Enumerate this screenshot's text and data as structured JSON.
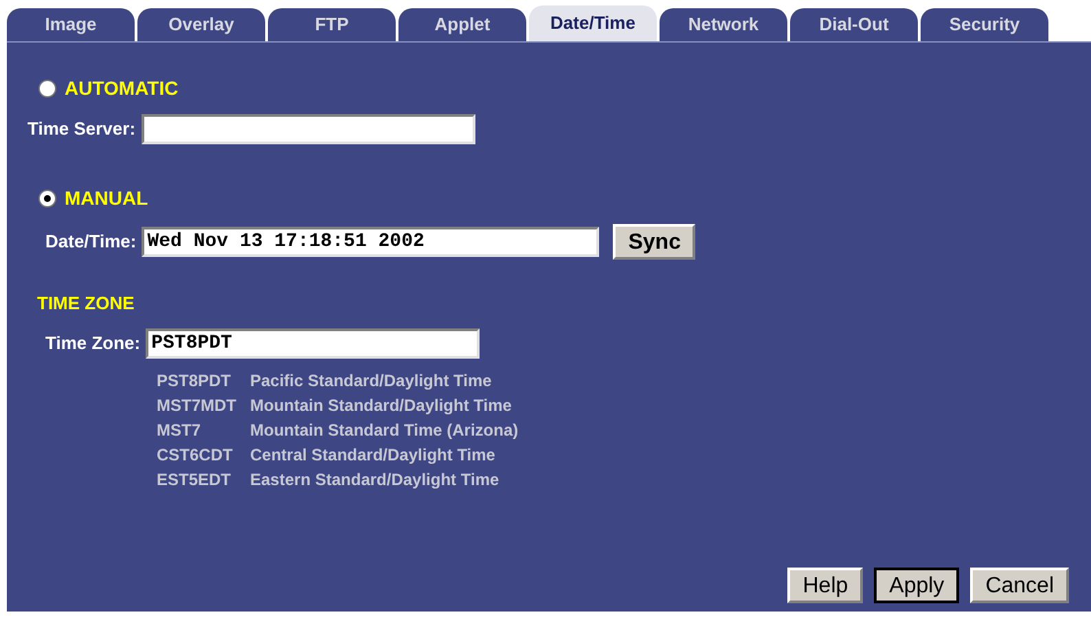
{
  "tabs": [
    {
      "label": "Image",
      "selected": false
    },
    {
      "label": "Overlay",
      "selected": false
    },
    {
      "label": "FTP",
      "selected": false
    },
    {
      "label": "Applet",
      "selected": false
    },
    {
      "label": "Date/Time",
      "selected": true
    },
    {
      "label": "Network",
      "selected": false
    },
    {
      "label": "Dial-Out",
      "selected": false
    },
    {
      "label": "Security",
      "selected": false
    }
  ],
  "automatic": {
    "label": "AUTOMATIC",
    "selected": false,
    "field_label": "Time Server:"
  },
  "manual": {
    "label": "MANUAL",
    "selected": true,
    "field_label": "Date/Time:",
    "value": "Wed Nov 13 17:18:51 2002",
    "button": "Sync"
  },
  "time_zone": {
    "heading": "TIME ZONE",
    "field_label": "Time Zone:",
    "value": "PST8PDT",
    "zones": [
      {
        "code": "PST8PDT",
        "name": "Pacific Standard/Daylight Time"
      },
      {
        "code": "MST7MDT",
        "name": "Mountain Standard/Daylight Time"
      },
      {
        "code": "MST7",
        "name": "Mountain Standard Time (Arizona)"
      },
      {
        "code": "CST6CDT",
        "name": "Central Standard/Daylight Time"
      },
      {
        "code": "EST5EDT",
        "name": "Eastern Standard/Daylight Time"
      }
    ]
  },
  "buttons": [
    {
      "label": "Help",
      "selected": false
    },
    {
      "label": "Apply",
      "selected": true
    },
    {
      "label": "Cancel",
      "selected": false
    }
  ]
}
